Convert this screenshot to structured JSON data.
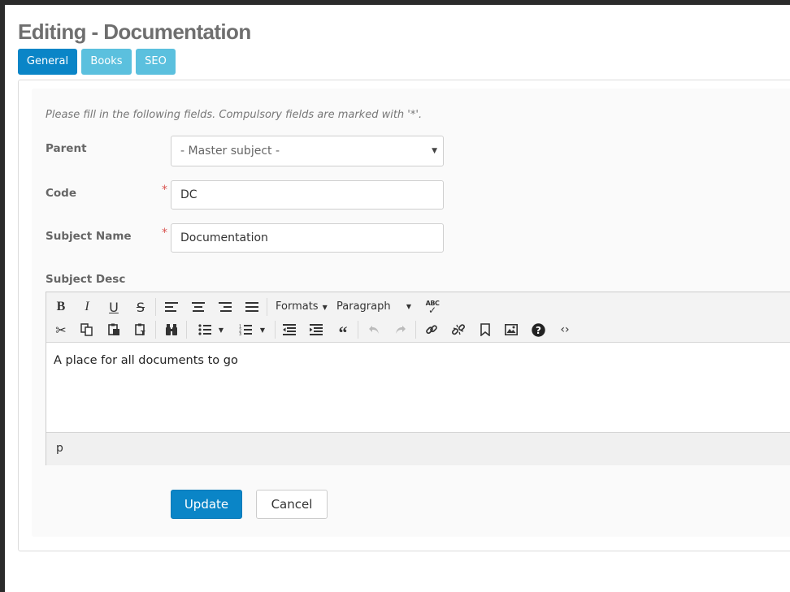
{
  "page": {
    "title": "Editing - Documentation"
  },
  "tabs": [
    {
      "label": "General",
      "active": true
    },
    {
      "label": "Books",
      "active": false
    },
    {
      "label": "SEO",
      "active": false
    }
  ],
  "form": {
    "hint": "Please fill in the following fields. Compulsory fields are marked with '*'.",
    "required_marker": "*",
    "parent": {
      "label": "Parent",
      "value": "- Master subject -"
    },
    "code": {
      "label": "Code",
      "value": "DC"
    },
    "subject_name": {
      "label": "Subject Name",
      "value": "Documentation"
    },
    "subject_desc": {
      "label": "Subject Desc"
    }
  },
  "editor": {
    "formats_label": "Formats",
    "paragraph_label": "Paragraph",
    "content": "A place for all documents to go",
    "path": "p",
    "toolbar_row1": [
      "bold",
      "italic",
      "underline",
      "strikethrough",
      "align-left",
      "align-center",
      "align-right",
      "align-justify",
      "formats",
      "paragraph",
      "spellcheck"
    ],
    "toolbar_row2": [
      "cut",
      "copy",
      "paste",
      "paste-text",
      "find-replace",
      "bullet-list",
      "numbered-list",
      "outdent",
      "indent",
      "blockquote",
      "undo",
      "redo",
      "link",
      "unlink",
      "bookmark",
      "image",
      "help",
      "source-code"
    ]
  },
  "actions": {
    "update_label": "Update",
    "cancel_label": "Cancel"
  },
  "colors": {
    "primary": "#0a85c7",
    "tab_inactive": "#5bc0de",
    "required": "#d9534f"
  }
}
